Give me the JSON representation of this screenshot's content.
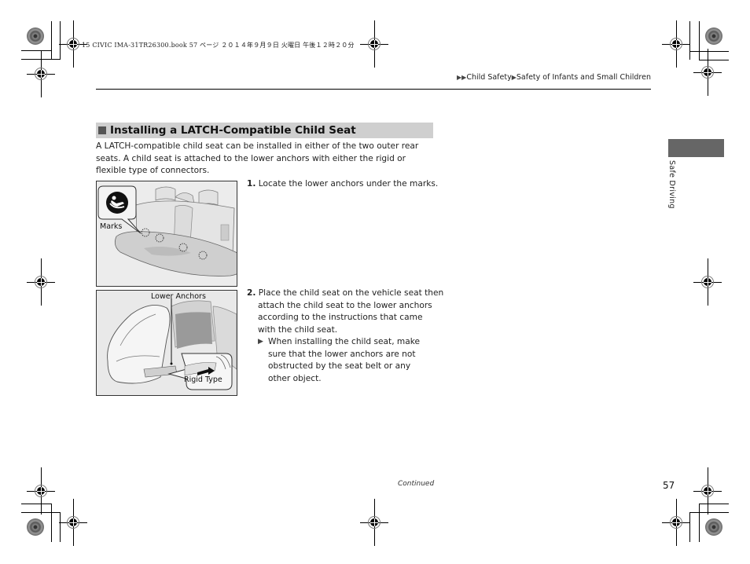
{
  "print_meta": {
    "header_line": "15 CIVIC IMA-31TR26300.book  57 ページ  ２０１４年９月９日  火曜日  午後１２時２０分"
  },
  "breadcrumb": {
    "arrow_icon": "double-triangle-right",
    "items": [
      "Child Safety",
      "Safety of Infants and Small Children"
    ]
  },
  "section": {
    "title": "Installing a LATCH-Compatible Child Seat",
    "intro": "A LATCH-compatible child seat can be installed in either of the two outer rear seats. A child seat is attached to the lower anchors with either the rigid or flexible type of connectors."
  },
  "figures": [
    {
      "labels": [
        "Marks"
      ],
      "icon": "child-seat-mark-icon"
    },
    {
      "labels": [
        "Lower Anchors",
        "Rigid Type"
      ]
    }
  ],
  "steps": [
    {
      "number": "1.",
      "text": "Locate the lower anchors under the marks."
    },
    {
      "number": "2.",
      "lines": [
        "Place the child seat on the vehicle seat then",
        "attach the child seat to the lower anchors",
        "according to the instructions that came",
        "with the child seat."
      ],
      "note": "When installing the child seat, make sure that the lower anchors are not obstructed by the seat belt or any other object."
    }
  ],
  "side_tab": {
    "label": "Safe Driving",
    "color": "#666666"
  },
  "footer": {
    "continued": "Continued",
    "page_number": "57"
  }
}
